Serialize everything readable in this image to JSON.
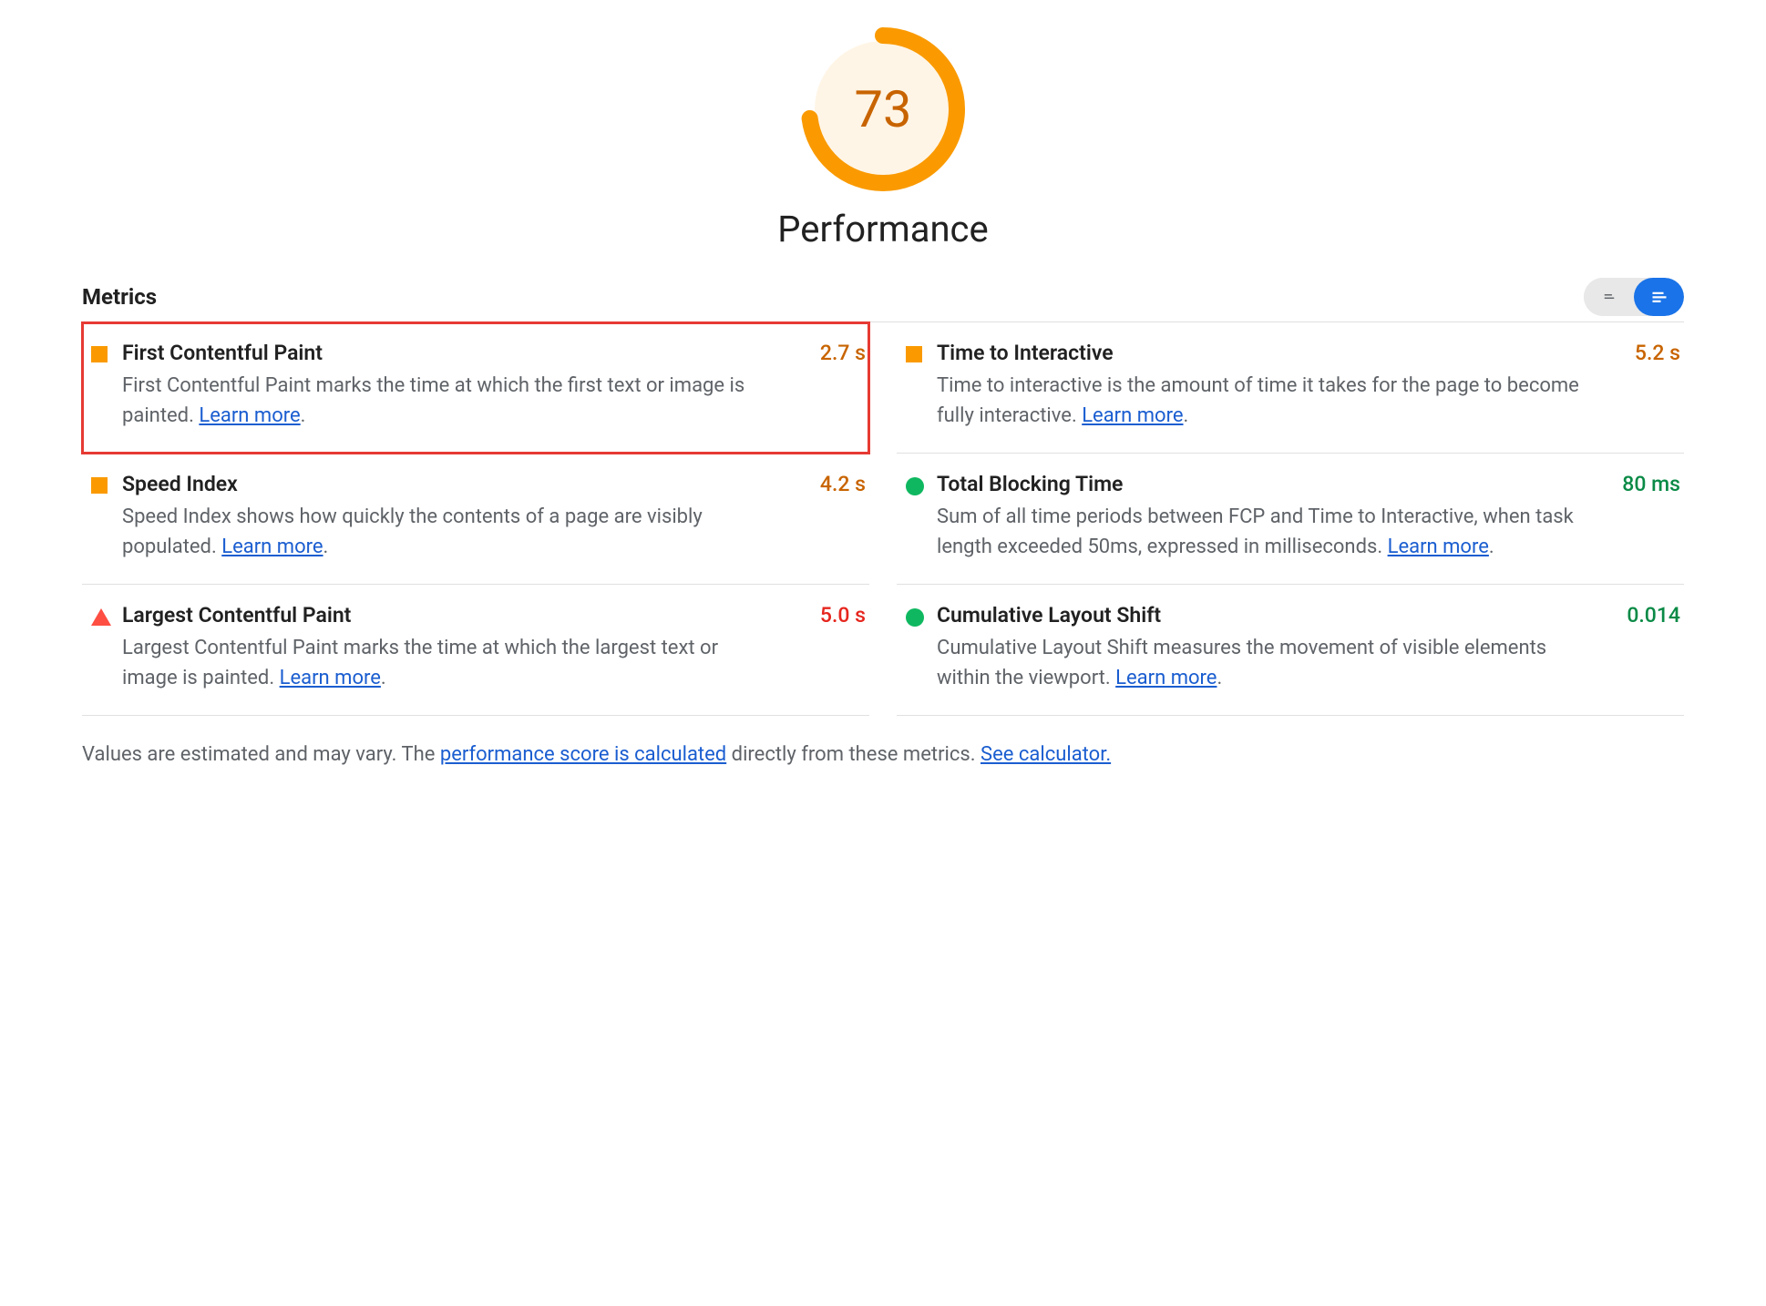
{
  "score": {
    "value": 73,
    "percent": 73,
    "color": "#fa9a00"
  },
  "title": "Performance",
  "sectionHeading": "Metrics",
  "learnMoreLabel": "Learn more",
  "metrics": [
    {
      "status": "average",
      "title": "First Contentful Paint",
      "value": "2.7 s",
      "valueClass": "val-orange",
      "desc": "First Contentful Paint marks the time at which the first text or image is painted. ",
      "highlight": true
    },
    {
      "status": "average",
      "title": "Time to Interactive",
      "value": "5.2 s",
      "valueClass": "val-orange",
      "desc": "Time to interactive is the amount of time it takes for the page to become fully interactive. "
    },
    {
      "status": "average",
      "title": "Speed Index",
      "value": "4.2 s",
      "valueClass": "val-orange",
      "desc": "Speed Index shows how quickly the contents of a page are visibly populated. "
    },
    {
      "status": "good",
      "title": "Total Blocking Time",
      "value": "80 ms",
      "valueClass": "val-green",
      "desc": "Sum of all time periods between FCP and Time to Interactive, when task length exceeded 50ms, expressed in milliseconds. "
    },
    {
      "status": "poor",
      "title": "Largest Contentful Paint",
      "value": "5.0 s",
      "valueClass": "val-red",
      "desc": "Largest Contentful Paint marks the time at which the largest text or image is painted. "
    },
    {
      "status": "good",
      "title": "Cumulative Layout Shift",
      "value": "0.014",
      "valueClass": "val-green",
      "desc": "Cumulative Layout Shift measures the movement of visible elements within the viewport. "
    }
  ],
  "footer": {
    "prefix": "Values are estimated and may vary. The ",
    "link1": "performance score is calculated",
    "mid": " directly from these metrics. ",
    "link2": "See calculator."
  }
}
